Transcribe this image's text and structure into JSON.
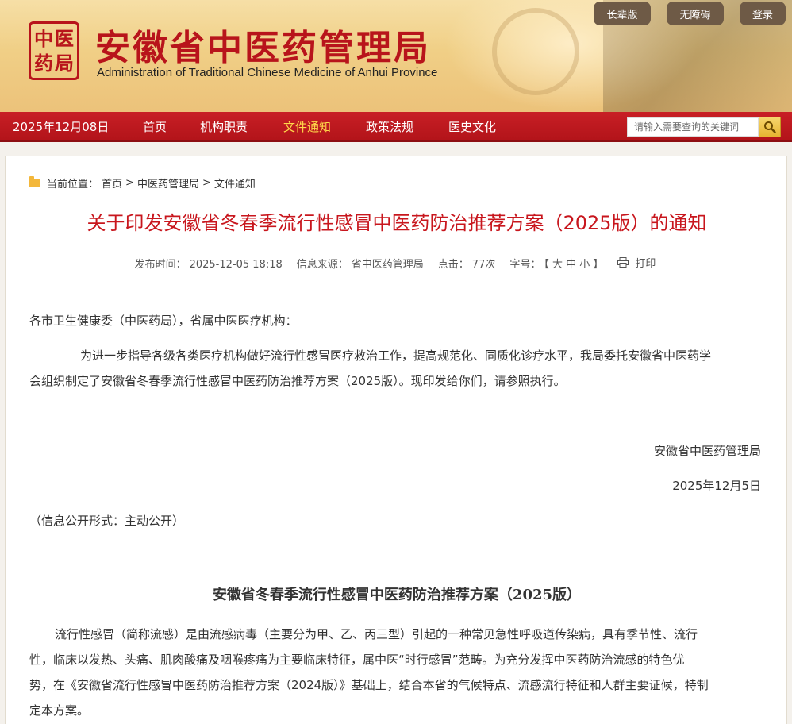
{
  "header": {
    "seal_chars": [
      "中",
      "医",
      "药",
      "局"
    ],
    "title": "安徽省中医药管理局",
    "subtitle": "Administration of Traditional Chinese Medicine of Anhui Province",
    "buttons": [
      "长辈版",
      "无障碍",
      "登录"
    ]
  },
  "nav": {
    "date": "2025年12月08日",
    "items": [
      "首页",
      "机构职责",
      "文件通知",
      "政策法规",
      "医史文化"
    ],
    "active": "文件通知",
    "search_placeholder": "请输入需要查询的关键词"
  },
  "breadcrumb": {
    "label": "当前位置：",
    "items": [
      "首页",
      "中医药管理局",
      "文件通知"
    ],
    "separator": ">"
  },
  "article": {
    "title": "关于印发安徽省冬春季流行性感冒中医药防治推荐方案（2025版）的通知",
    "meta": {
      "publish_label": "发布时间：",
      "publish_time": "2025-12-05 18:18",
      "source_label": "信息来源：",
      "source": "省中医药管理局",
      "clicks_label": "点击：",
      "clicks": "77次",
      "font_label": "字号：",
      "font_sizes": "【 大 中 小 】",
      "print": "打印"
    },
    "salutation": "各市卫生健康委（中医药局），省属中医医疗机构：",
    "body_line1": "为进一步指导各级各类医疗机构做好流行性感冒医疗救治工作，提高规范化、同质化诊疗水平，我局委托安徽省中医药学",
    "body_line2": "会组织制定了安徽省冬春季流行性感冒中医药防治推荐方案（2025版）。现印发给你们，请参照执行。",
    "signature": "安徽省中医药管理局",
    "date": "2025年12月5日",
    "disclosure": "（信息公开形式：主动公开）",
    "doc_title": "安徽省冬春季流行性感冒中医药防治推荐方案（2025版）",
    "doc_line1": "流行性感冒（简称流感）是由流感病毒（主要分为甲、乙、丙三型）引起的一种常见急性呼吸道传染病，具有季节性、流行",
    "doc_line2": "性，临床以发热、头痛、肌肉酸痛及咽喉疼痛为主要临床特征，属中医“时行感冒”范畴。为充分发挥中医药防治流感的特色优",
    "doc_line3": "势，在《安徽省流行性感冒中医药防治推荐方案（2024版）》基础上，结合本省的气候特点、流感流行特征和人群主要证候，特制",
    "doc_line4": "定本方案。"
  }
}
